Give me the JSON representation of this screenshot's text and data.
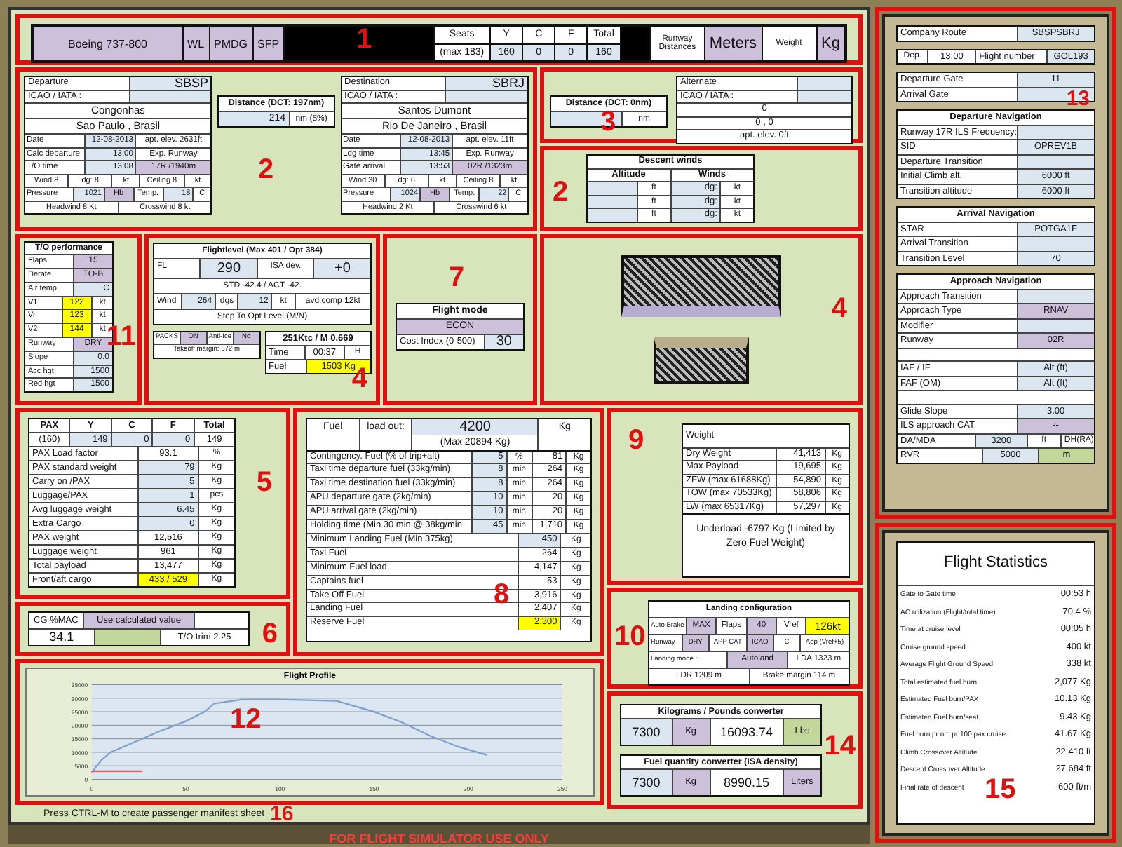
{
  "header": {
    "number": "1",
    "aircraft": "Boeing 737-800",
    "tags": [
      "WL",
      "PMDG",
      "SFP"
    ],
    "seats_label": "Seats",
    "seats_max": "(max 183)",
    "seat_columns": [
      "Y",
      "C",
      "F",
      "Total"
    ],
    "seat_values": [
      "160",
      "0",
      "0",
      "160"
    ],
    "runway_label": "Runway Distances",
    "runway_unit": "Meters",
    "weight_label": "Weight",
    "weight_unit": "Kg"
  },
  "departure": {
    "number": "2",
    "blocks": [
      [
        [
          {
            "text": "Departure",
            "kind": "label"
          },
          {
            "text": "SBSP",
            "kind": "input"
          }
        ],
        [
          {
            "text": "ICAO / IATA :",
            "kind": "label"
          },
          {
            "kind": "input"
          }
        ]
      ],
      [
        [
          {
            "text": "Congonhas",
            "kind": "text"
          }
        ],
        [
          {
            "text": "Sao Paulo , Brasil",
            "kind": "text"
          }
        ]
      ],
      [
        [
          {
            "text": "Date",
            "kind": "label"
          },
          {
            "text": "12-08-2013",
            "kind": "input"
          },
          {
            "text": "apt. elev. 2631ft",
            "kind": "text"
          }
        ],
        [
          {
            "text": "Calc departure",
            "kind": "label"
          },
          {
            "text": "13:00",
            "kind": "input"
          },
          {
            "text": "Exp. Runway",
            "kind": "text"
          }
        ],
        [
          {
            "text": "T/O time",
            "kind": "label"
          },
          {
            "text": "13:08",
            "kind": "input"
          },
          {
            "text": "17R /1940m",
            "kind": "option"
          }
        ]
      ],
      [
        [
          {
            "text": "Wind 8",
            "kind": "text"
          },
          {
            "text": "dg: 8",
            "kind": "text"
          },
          {
            "text": "kt",
            "kind": "unit"
          },
          {
            "text": "Ceiling 8",
            "kind": "text"
          },
          {
            "text": "kt",
            "kind": "unit"
          }
        ]
      ],
      [
        [
          {
            "text": "Pressure",
            "kind": "label"
          },
          {
            "text": "1021",
            "kind": "input"
          },
          {
            "text": "Hb",
            "kind": "option"
          },
          {
            "text": "Temp.",
            "kind": "text"
          },
          {
            "text": "18",
            "kind": "input"
          },
          {
            "text": "C",
            "kind": "unit"
          }
        ]
      ],
      [
        [
          {
            "text": "Headwind 8 Kt",
            "kind": "text"
          },
          {
            "text": "Crosswind 8 kt",
            "kind": "text"
          }
        ]
      ]
    ]
  },
  "route_distance": {
    "rows": [
      [
        {
          "text": "Distance (DCT: 197nm)",
          "kind": "head"
        }
      ],
      [
        {
          "text": "214",
          "kind": "input"
        },
        {
          "text": "nm (8%)",
          "kind": "unit"
        }
      ]
    ]
  },
  "destination": {
    "blocks": [
      [
        [
          {
            "text": "Destination",
            "kind": "label"
          },
          {
            "text": "SBRJ",
            "kind": "input"
          }
        ],
        [
          {
            "text": "ICAO / IATA :",
            "kind": "label"
          },
          {
            "kind": "input"
          }
        ]
      ],
      [
        [
          {
            "text": "Santos Dumont",
            "kind": "text"
          }
        ],
        [
          {
            "text": "Rio De Janeiro , Brasil",
            "kind": "text"
          }
        ]
      ],
      [
        [
          {
            "text": "Date",
            "kind": "label"
          },
          {
            "text": "12-08-2013",
            "kind": "input"
          },
          {
            "text": "apt. elev. 11ft",
            "kind": "text"
          }
        ],
        [
          {
            "text": "Ldg time",
            "kind": "label"
          },
          {
            "text": "13:45",
            "kind": "input"
          },
          {
            "text": "Exp. Runway",
            "kind": "text"
          }
        ],
        [
          {
            "text": "Gate arrival",
            "kind": "label"
          },
          {
            "text": "13:53",
            "kind": "input"
          },
          {
            "text": "02R /1323m",
            "kind": "option"
          }
        ]
      ],
      [
        [
          {
            "text": "Wind 30",
            "kind": "text"
          },
          {
            "text": "dg: 6",
            "kind": "text"
          },
          {
            "text": "kt",
            "kind": "unit"
          },
          {
            "text": "Ceiling 8",
            "kind": "text"
          },
          {
            "text": "kt",
            "kind": "unit"
          }
        ]
      ],
      [
        [
          {
            "text": "Pressure",
            "kind": "label"
          },
          {
            "text": "1024",
            "kind": "input"
          },
          {
            "text": "Hb",
            "kind": "option"
          },
          {
            "text": "Temp.",
            "kind": "text"
          },
          {
            "text": "22",
            "kind": "input"
          },
          {
            "text": "C",
            "kind": "unit"
          }
        ]
      ],
      [
        [
          {
            "text": "Headwind 2 Kt",
            "kind": "text"
          },
          {
            "text": "Crosswind 6 kt",
            "kind": "text"
          }
        ]
      ]
    ]
  },
  "alternate": {
    "number": "3",
    "distance_rows": [
      [
        {
          "text": "Distance (DCT: 0nm)",
          "kind": "head"
        }
      ],
      [
        {
          "kind": "input"
        },
        {
          "text": "nm",
          "kind": "unit"
        }
      ]
    ],
    "rows": [
      [
        {
          "text": "Alternate",
          "kind": "label"
        },
        {
          "kind": "input"
        }
      ],
      [
        {
          "text": "ICAO / IATA :",
          "kind": "label"
        },
        {
          "kind": "input"
        }
      ],
      [
        {
          "text": "0",
          "kind": "text"
        }
      ],
      [
        {
          "text": "0 , 0",
          "kind": "text"
        }
      ],
      [
        {
          "text": "apt. elev. 0ft",
          "kind": "text"
        }
      ]
    ]
  },
  "descent_winds": {
    "number": "2",
    "blocks": [
      [
        [
          {
            "text": "Descent winds",
            "kind": "head"
          }
        ]
      ],
      [
        [
          {
            "text": "Altitude",
            "kind": "head"
          },
          {
            "text": "Winds",
            "kind": "head"
          }
        ]
      ],
      [
        [
          {
            "kind": "input"
          },
          {
            "text": "ft",
            "kind": "unit"
          },
          {
            "text": "dg:",
            "kind": "input"
          },
          {
            "text": "kt",
            "kind": "unit"
          }
        ],
        [
          {
            "kind": "input"
          },
          {
            "text": "ft",
            "kind": "unit"
          },
          {
            "text": "dg:",
            "kind": "input"
          },
          {
            "text": "kt",
            "kind": "unit"
          }
        ],
        [
          {
            "kind": "input"
          },
          {
            "text": "ft",
            "kind": "unit"
          },
          {
            "text": "dg:",
            "kind": "input"
          },
          {
            "text": "kt",
            "kind": "unit"
          }
        ]
      ]
    ]
  },
  "takeoff": {
    "number": "11",
    "rows": [
      [
        {
          "text": "T/O performance",
          "kind": "head"
        }
      ],
      [
        {
          "text": "Flaps",
          "kind": "label"
        },
        {
          "text": "15",
          "kind": "option"
        }
      ],
      [
        {
          "text": "Derate",
          "kind": "label"
        },
        {
          "text": "TO-B",
          "kind": "option"
        }
      ],
      [
        {
          "text": "Air temp.",
          "kind": "label"
        },
        {
          "text": "C",
          "kind": "input"
        }
      ],
      [
        {
          "text": "V1",
          "kind": "label"
        },
        {
          "text": "122",
          "kind": "highlight"
        },
        {
          "text": "kt",
          "kind": "unit"
        }
      ],
      [
        {
          "text": "Vr",
          "kind": "label"
        },
        {
          "text": "123",
          "kind": "highlight"
        },
        {
          "text": "kt",
          "kind": "unit"
        }
      ],
      [
        {
          "text": "V2",
          "kind": "label"
        },
        {
          "text": "144",
          "kind": "highlight"
        },
        {
          "text": "kt",
          "kind": "unit"
        }
      ],
      [
        {
          "text": "Runway",
          "kind": "label"
        },
        {
          "text": "DRY",
          "kind": "option"
        }
      ],
      [
        {
          "text": "Slope",
          "kind": "label"
        },
        {
          "text": "0.0",
          "kind": "input"
        }
      ],
      [
        {
          "text": "Acc hgt",
          "kind": "label"
        },
        {
          "text": "1500",
          "kind": "input"
        }
      ],
      [
        {
          "text": "Red hgt",
          "kind": "label"
        },
        {
          "text": "1500",
          "kind": "input"
        }
      ]
    ],
    "extra_rows": [
      [
        {
          "text": "PACKS",
          "kind": "text"
        },
        {
          "text": "ON",
          "kind": "option"
        },
        {
          "text": "Anti-Ice",
          "kind": "text"
        },
        {
          "text": "No",
          "kind": "option"
        }
      ],
      [
        {
          "text": "Takeoff margin: 572 m",
          "kind": "text"
        }
      ]
    ]
  },
  "flight_level": {
    "number": "4",
    "blocks": [
      [
        [
          {
            "text": "Flightlevel (Max 401 / Opt 384)",
            "kind": "head"
          }
        ]
      ],
      [
        [
          {
            "text": "FL",
            "kind": "label"
          },
          {
            "text": "290",
            "kind": "input"
          },
          {
            "text": "ISA dev.",
            "kind": "text"
          },
          {
            "text": "+0",
            "kind": "input"
          }
        ]
      ],
      [
        [
          {
            "text": "STD -42.4 / ACT -42.",
            "kind": "text"
          }
        ]
      ],
      [
        [
          {
            "text": "Wind",
            "kind": "label"
          },
          {
            "text": "264",
            "kind": "input"
          },
          {
            "text": "dgs",
            "kind": "unit"
          },
          {
            "text": "12",
            "kind": "input"
          },
          {
            "text": "kt",
            "kind": "unit"
          },
          {
            "text": "avd.comp 12kt",
            "kind": "text"
          }
        ]
      ],
      [
        [
          {
            "text": "Step To Opt Level (M/N)",
            "kind": "text"
          }
        ]
      ]
    ],
    "cruise_rows": [
      [
        {
          "text": "251Ktc / M 0.669",
          "kind": "head"
        }
      ],
      [
        {
          "text": "Time",
          "kind": "label"
        },
        {
          "text": "00:37",
          "kind": "text"
        },
        {
          "text": "H",
          "kind": "unit"
        }
      ],
      [
        {
          "text": "Fuel",
          "kind": "label"
        },
        {
          "text": "1503 Kg",
          "kind": "highlight"
        }
      ]
    ]
  },
  "flight_mode": {
    "number": "7",
    "rows": [
      [
        {
          "text": "Flight mode",
          "kind": "head"
        }
      ],
      [
        {
          "text": "ECON",
          "kind": "option"
        }
      ],
      [
        {
          "text": "Cost Index (0-500)",
          "kind": "label"
        },
        {
          "text": "30",
          "kind": "input"
        }
      ]
    ]
  },
  "hidden_panels": {
    "number": "4"
  },
  "passengers": {
    "number": "5",
    "rows": [
      [
        {
          "text": "PAX",
          "kind": "head"
        },
        {
          "text": "Y",
          "kind": "head"
        },
        {
          "text": "C",
          "kind": "head"
        },
        {
          "text": "F",
          "kind": "head"
        },
        {
          "text": "Total",
          "kind": "head"
        }
      ],
      [
        {
          "text": "(160)",
          "kind": "text"
        },
        {
          "text": "149",
          "kind": "input"
        },
        {
          "text": "0",
          "kind": "input"
        },
        {
          "text": "0",
          "kind": "input"
        },
        {
          "text": "149",
          "kind": "text"
        }
      ],
      [
        {
          "text": "PAX Load factor",
          "kind": "label"
        },
        {
          "text": "93.1",
          "kind": "text"
        },
        {
          "text": "%",
          "kind": "unit"
        }
      ],
      [
        {
          "text": "PAX standard weight",
          "kind": "label"
        },
        {
          "text": "79",
          "kind": "input"
        },
        {
          "text": "Kg",
          "kind": "unit"
        }
      ],
      [
        {
          "text": "Carry on /PAX",
          "kind": "label"
        },
        {
          "text": "5",
          "kind": "input"
        },
        {
          "text": "Kg",
          "kind": "unit"
        }
      ],
      [
        {
          "text": "Luggage/PAX",
          "kind": "label"
        },
        {
          "text": "1",
          "kind": "input"
        },
        {
          "text": "pcs",
          "kind": "unit"
        }
      ],
      [
        {
          "text": "Avg luggage weight",
          "kind": "label"
        },
        {
          "text": "6.45",
          "kind": "input"
        },
        {
          "text": "Kg",
          "kind": "unit"
        }
      ],
      [
        {
          "text": "Extra Cargo",
          "kind": "label"
        },
        {
          "text": "0",
          "kind": "input"
        },
        {
          "text": "Kg",
          "kind": "unit"
        }
      ],
      [
        {
          "text": "PAX weight",
          "kind": "label"
        },
        {
          "text": "12,516",
          "kind": "text"
        },
        {
          "text": "Kg",
          "kind": "unit"
        }
      ],
      [
        {
          "text": "Luggage weight",
          "kind": "label"
        },
        {
          "text": "961",
          "kind": "text"
        },
        {
          "text": "Kg",
          "kind": "unit"
        }
      ],
      [
        {
          "text": "Total payload",
          "kind": "label"
        },
        {
          "text": "13,477",
          "kind": "text"
        },
        {
          "text": "Kg",
          "kind": "unit"
        }
      ],
      [
        {
          "text": "Front/aft cargo",
          "kind": "label"
        },
        {
          "text": "433 / 529",
          "kind": "highlight"
        },
        {
          "text": "Kg",
          "kind": "unit"
        }
      ]
    ]
  },
  "center_of_gravity": {
    "number": "6",
    "rows": [
      [
        {
          "text": "CG %MAC",
          "kind": "text"
        },
        {
          "text": "Use calculated value",
          "kind": "option"
        },
        {
          "kind": "text"
        }
      ],
      [
        {
          "text": "34.1",
          "kind": "text"
        },
        {
          "kind": "green"
        },
        {
          "text": "T/O trim 2.25",
          "kind": "text"
        }
      ]
    ]
  },
  "fuel": {
    "number": "8",
    "title_rows": [
      [
        {
          "text": "Fuel",
          "kind": "text"
        },
        {
          "text": "load out:",
          "kind": "text"
        },
        {
          "text": "4200",
          "kind": "input"
        },
        {
          "text": "Kg",
          "kind": "text"
        }
      ],
      [
        {
          "kind": "text"
        },
        {
          "kind": "text"
        },
        {
          "text": "(Max 20894 Kg)",
          "kind": "text"
        },
        {
          "kind": "text"
        }
      ]
    ],
    "rows": [
      [
        {
          "text": "Contingency. Fuel (% of trip+alt)",
          "kind": "label"
        },
        {
          "text": "5",
          "kind": "input"
        },
        {
          "text": "%",
          "kind": "unit"
        },
        {
          "text": "81",
          "kind": "text"
        },
        {
          "text": "Kg",
          "kind": "unit"
        }
      ],
      [
        {
          "text": "Taxi time departure fuel (33kg/min)",
          "kind": "label"
        },
        {
          "text": "8",
          "kind": "input"
        },
        {
          "text": "min",
          "kind": "unit"
        },
        {
          "text": "264",
          "kind": "text"
        },
        {
          "text": "Kg",
          "kind": "unit"
        }
      ],
      [
        {
          "text": "Taxi time destination fuel (33kg/min)",
          "kind": "label"
        },
        {
          "text": "8",
          "kind": "input"
        },
        {
          "text": "min",
          "kind": "unit"
        },
        {
          "text": "264",
          "kind": "text"
        },
        {
          "text": "Kg",
          "kind": "unit"
        }
      ],
      [
        {
          "text": "APU departure gate (2kg/min)",
          "kind": "label"
        },
        {
          "text": "10",
          "kind": "input"
        },
        {
          "text": "min",
          "kind": "unit"
        },
        {
          "text": "20",
          "kind": "text"
        },
        {
          "text": "Kg",
          "kind": "unit"
        }
      ],
      [
        {
          "text": "APU arrival gate (2kg/min)",
          "kind": "label"
        },
        {
          "text": "10",
          "kind": "input"
        },
        {
          "text": "min",
          "kind": "unit"
        },
        {
          "text": "20",
          "kind": "text"
        },
        {
          "text": "Kg",
          "kind": "unit"
        }
      ],
      [
        {
          "text": "Holding time (Min 30 min @ 38kg/min",
          "kind": "label"
        },
        {
          "text": "45",
          "kind": "input"
        },
        {
          "text": "min",
          "kind": "unit"
        },
        {
          "text": "1,710",
          "kind": "text"
        },
        {
          "text": "Kg",
          "kind": "unit"
        }
      ],
      [
        {
          "text": "Minimum Landing Fuel (Min 375kg)",
          "kind": "label"
        },
        {
          "text": "450",
          "kind": "input"
        },
        {
          "text": "Kg",
          "kind": "unit"
        }
      ],
      [
        {
          "text": "Taxi Fuel",
          "kind": "label"
        },
        {
          "text": "264",
          "kind": "text"
        },
        {
          "text": "Kg",
          "kind": "unit"
        }
      ],
      [
        {
          "text": "Minimum Fuel load",
          "kind": "label"
        },
        {
          "text": "4,147",
          "kind": "text"
        },
        {
          "text": "Kg",
          "kind": "unit"
        }
      ],
      [
        {
          "text": "Captains fuel",
          "kind": "label"
        },
        {
          "text": "53",
          "kind": "text"
        },
        {
          "text": "Kg",
          "kind": "unit"
        }
      ],
      [
        {
          "text": "Take Off Fuel",
          "kind": "label"
        },
        {
          "text": "3,916",
          "kind": "text"
        },
        {
          "text": "Kg",
          "kind": "unit"
        }
      ],
      [
        {
          "text": "Landing Fuel",
          "kind": "label"
        },
        {
          "text": "2,407",
          "kind": "text"
        },
        {
          "text": "Kg",
          "kind": "unit"
        }
      ],
      [
        {
          "text": "Reserve Fuel",
          "kind": "label"
        },
        {
          "text": "2,300",
          "kind": "highlight"
        },
        {
          "text": "Kg",
          "kind": "unit"
        }
      ]
    ]
  },
  "weight": {
    "number": "9",
    "rows": [
      [
        {
          "text": "Weight",
          "kind": "label"
        }
      ],
      [
        {
          "text": "Dry Weight",
          "kind": "label"
        },
        {
          "text": "41,413",
          "kind": "text"
        },
        {
          "text": "Kg",
          "kind": "unit"
        }
      ],
      [
        {
          "text": "Max Payload",
          "kind": "label"
        },
        {
          "text": "19,695",
          "kind": "text"
        },
        {
          "text": "Kg",
          "kind": "unit"
        }
      ],
      [
        {
          "text": "ZFW (max 61688Kg)",
          "kind": "label"
        },
        {
          "text": "54,890",
          "kind": "text"
        },
        {
          "text": "Kg",
          "kind": "unit"
        }
      ],
      [
        {
          "text": "TOW (max 70533Kg)",
          "kind": "label"
        },
        {
          "text": "58,806",
          "kind": "text"
        },
        {
          "text": "Kg",
          "kind": "unit"
        }
      ],
      [
        {
          "text": "LW (max 65317Kg)",
          "kind": "label"
        },
        {
          "text": "57,297",
          "kind": "text"
        },
        {
          "text": "Kg",
          "kind": "unit"
        }
      ]
    ],
    "note": "Underload -6797 Kg (Limited by Zero Fuel Weight)"
  },
  "landing": {
    "number": "10",
    "blocks": [
      [
        [
          {
            "text": "Landing configuration",
            "kind": "head"
          }
        ]
      ],
      [
        [
          {
            "text": "Auto Brake",
            "kind": "label"
          },
          {
            "text": "MAX",
            "kind": "option"
          },
          {
            "text": "Flaps",
            "kind": "text"
          },
          {
            "text": "40",
            "kind": "option"
          },
          {
            "text": "Vref",
            "kind": "text"
          },
          {
            "text": "126kt",
            "kind": "highlight"
          }
        ]
      ],
      [
        [
          {
            "text": "Runway",
            "kind": "label"
          },
          {
            "text": "DRY",
            "kind": "option"
          },
          {
            "text": "APP CAT",
            "kind": "text"
          },
          {
            "text": "ICAO",
            "kind": "option"
          },
          {
            "text": "C",
            "kind": "text"
          },
          {
            "text": "App (Vref+5)",
            "kind": "text"
          }
        ]
      ],
      [
        [
          {
            "text": "Landing mode :",
            "kind": "label"
          },
          {
            "text": "Autoland",
            "kind": "option"
          },
          {
            "text": "LDA 1323 m",
            "kind": "text"
          }
        ]
      ],
      [
        [
          {
            "text": "LDR 1209 m",
            "kind": "text"
          },
          {
            "text": "Brake margin 114 m",
            "kind": "text"
          }
        ]
      ]
    ]
  },
  "converters": {
    "number": "14",
    "tables": [
      [
        [
          {
            "text": "Kilograms / Pounds converter",
            "kind": "head"
          }
        ],
        [
          {
            "text": "7300",
            "kind": "input"
          },
          {
            "text": "Kg",
            "kind": "option"
          },
          {
            "text": "16093.74",
            "kind": "text"
          },
          {
            "text": "Lbs",
            "kind": "green"
          }
        ]
      ],
      [
        [
          {
            "text": "Fuel quantity converter (ISA density)",
            "kind": "head"
          }
        ],
        [
          {
            "text": "7300",
            "kind": "input"
          },
          {
            "text": "Kg",
            "kind": "option"
          },
          {
            "text": "8990.15",
            "kind": "text"
          },
          {
            "text": "Liters",
            "kind": "option"
          }
        ]
      ]
    ]
  },
  "flight_profile": {
    "number": "12",
    "chart_data": {
      "type": "line",
      "title": "Flight Profile",
      "grid": true,
      "x": [
        0,
        5,
        10,
        20,
        27,
        35,
        50,
        60,
        65,
        80,
        100,
        130,
        150,
        165,
        180,
        195,
        210
      ],
      "series": [
        {
          "color": "#7f9fcf",
          "values": [
            2500,
            7000,
            10000,
            13000,
            15000,
            17500,
            21500,
            25000,
            28000,
            29500,
            29500,
            29000,
            25000,
            21000,
            16000,
            12000,
            9000
          ]
        },
        {
          "color": "#e06060",
          "values": [
            3000,
            3000,
            3000,
            3000,
            3000,
            null,
            null,
            null,
            null,
            null,
            null,
            null,
            null,
            null,
            null,
            null,
            null
          ]
        }
      ],
      "xlim": [
        0,
        250
      ],
      "ylim": [
        0,
        35000
      ],
      "xticks": [
        0,
        50,
        100,
        150,
        200,
        250
      ],
      "yticks": [
        0,
        5000,
        10000,
        15000,
        20000,
        25000,
        30000,
        35000
      ]
    }
  },
  "manifest_hint": {
    "number": "16",
    "text": "Press CTRL-M to create passenger manifest sheet"
  },
  "footer": "FOR FLIGHT SIMULATOR USE ONLY",
  "flight_info": {
    "number": "13",
    "blocks": [
      [
        [
          {
            "text": "Company Route",
            "kind": "label"
          },
          {
            "text": "SBSPSBRJ",
            "kind": "input"
          }
        ]
      ],
      [
        [
          {
            "text": "Dep.",
            "kind": "unit"
          },
          {
            "text": "13:00",
            "kind": "text"
          },
          {
            "text": "Flight number",
            "kind": "label"
          },
          {
            "text": "GOL193",
            "kind": "input"
          }
        ]
      ],
      [
        [
          {
            "text": "Departure Gate",
            "kind": "label"
          },
          {
            "text": "11",
            "kind": "input"
          }
        ],
        [
          {
            "text": "Arrival Gate",
            "kind": "label"
          },
          {
            "kind": "input"
          }
        ]
      ],
      [
        [
          {
            "text": "Departure Navigation",
            "kind": "head"
          }
        ],
        [
          {
            "text": "Runway 17R ILS Frequency:",
            "kind": "label"
          },
          {
            "kind": "input"
          }
        ],
        [
          {
            "text": "SID",
            "kind": "label"
          },
          {
            "text": "OPREV1B",
            "kind": "input"
          }
        ],
        [
          {
            "text": "Departure Transition",
            "kind": "label"
          },
          {
            "kind": "input"
          }
        ],
        [
          {
            "text": "Initial Climb alt.",
            "kind": "label"
          },
          {
            "text": "6000  ft",
            "kind": "input"
          }
        ],
        [
          {
            "text": "Transition altitude",
            "kind": "label"
          },
          {
            "text": "6000  ft",
            "kind": "input"
          }
        ]
      ],
      [
        [
          {
            "text": "Arrival Navigation",
            "kind": "head"
          }
        ],
        [
          {
            "text": "STAR",
            "kind": "label"
          },
          {
            "text": "POTGA1F",
            "kind": "input"
          }
        ],
        [
          {
            "text": "Arrival Transition",
            "kind": "label"
          },
          {
            "kind": "input"
          }
        ],
        [
          {
            "text": "Transition Level",
            "kind": "label"
          },
          {
            "text": "70",
            "kind": "input"
          }
        ]
      ],
      [
        [
          {
            "text": "Approach Navigation",
            "kind": "head"
          }
        ],
        [
          {
            "text": "Approach Transition",
            "kind": "label"
          },
          {
            "kind": "input"
          }
        ],
        [
          {
            "text": "Approach Type",
            "kind": "label"
          },
          {
            "text": "RNAV",
            "kind": "option"
          }
        ],
        [
          {
            "text": "Modifier",
            "kind": "label"
          },
          {
            "kind": "input"
          }
        ],
        [
          {
            "text": "Runway",
            "kind": "label"
          },
          {
            "text": "02R",
            "kind": "option"
          }
        ],
        [
          {
            "kind": "text"
          }
        ],
        [
          {
            "text": "IAF / IF",
            "kind": "label"
          },
          {
            "text": "Alt (ft)",
            "kind": "input"
          }
        ],
        [
          {
            "text": "FAF (OM)",
            "kind": "label"
          },
          {
            "text": "Alt (ft)",
            "kind": "input"
          }
        ],
        [
          {
            "kind": "text"
          }
        ],
        [
          {
            "text": "Glide Slope",
            "kind": "label"
          },
          {
            "text": "3.00",
            "kind": "input"
          }
        ],
        [
          {
            "text": "ILS approach CAT",
            "kind": "label"
          },
          {
            "text": "--",
            "kind": "option"
          }
        ],
        [
          {
            "text": "DA/MDA",
            "kind": "label"
          },
          {
            "text": "3200",
            "kind": "input"
          },
          {
            "text": "ft",
            "kind": "unit"
          },
          {
            "text": "DH(RA)",
            "kind": "unit"
          }
        ],
        [
          {
            "text": "RVR",
            "kind": "label"
          },
          {
            "text": "5000",
            "kind": "input"
          },
          {
            "text": "m",
            "kind": "green"
          }
        ]
      ]
    ]
  },
  "statistics": {
    "number": "15",
    "title": "Flight Statistics",
    "rows": [
      [
        {
          "text": "Gate to Gate time",
          "kind": "label"
        },
        {
          "text": "00:53  h",
          "kind": "text"
        }
      ],
      [
        {
          "text": "AC utilization (Flight/total time)",
          "kind": "label"
        },
        {
          "text": "70.4  %",
          "kind": "text"
        }
      ],
      [
        {
          "text": "Time at cruise level",
          "kind": "label"
        },
        {
          "text": "00:05  h",
          "kind": "text"
        }
      ],
      [
        {
          "text": "Cruise ground speed",
          "kind": "label"
        },
        {
          "text": "400  kt",
          "kind": "text"
        }
      ],
      [
        {
          "text": "Average Flight Ground Speed",
          "kind": "label"
        },
        {
          "text": "338  kt",
          "kind": "text"
        }
      ],
      [
        {
          "text": "Total estimated fuel burn",
          "kind": "label"
        },
        {
          "text": "2,077  Kg",
          "kind": "text"
        }
      ],
      [
        {
          "text": "Estimated Fuel burn/PAX",
          "kind": "label"
        },
        {
          "text": "10.13  Kg",
          "kind": "text"
        }
      ],
      [
        {
          "text": "Estimated Fuel burn/seat",
          "kind": "label"
        },
        {
          "text": "9.43  Kg",
          "kind": "text"
        }
      ],
      [
        {
          "text": "Fuel burn pr nm pr 100 pax cruise",
          "kind": "label"
        },
        {
          "text": "41.67  Kg",
          "kind": "text"
        }
      ],
      [
        {
          "text": "Climb Crossover Altitude",
          "kind": "label"
        },
        {
          "text": "22,410  ft",
          "kind": "text"
        }
      ],
      [
        {
          "text": "Descent Crossover Altitude",
          "kind": "label"
        },
        {
          "text": "27,684  ft",
          "kind": "text"
        }
      ],
      [
        {
          "text": "Final rate of descent",
          "kind": "label"
        },
        {
          "text": "-600  ft/m",
          "kind": "text"
        }
      ]
    ]
  }
}
